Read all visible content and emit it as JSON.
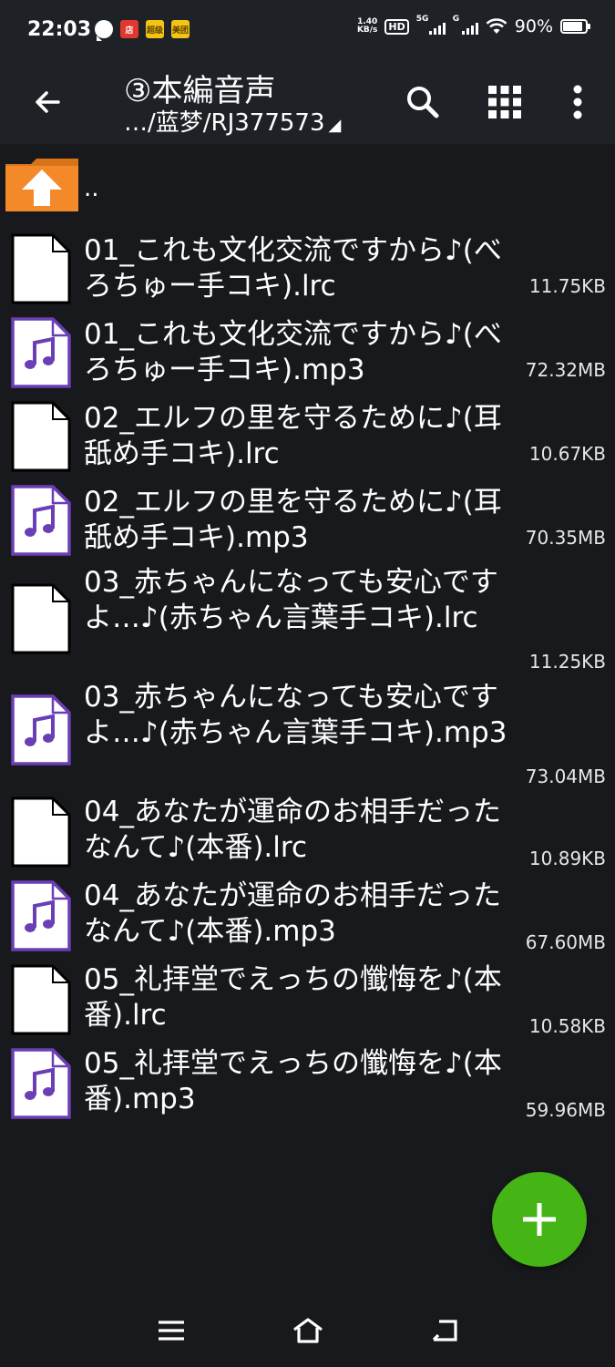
{
  "status_bar": {
    "time": "22:03",
    "badge_1": "店",
    "badge_2": "超级",
    "badge_3": "美团",
    "speed_value": "1.40",
    "speed_unit": "KB/s",
    "hd_label": "HD",
    "sig1_label": "5G",
    "sig2_label": "G",
    "battery": "90%"
  },
  "app_bar": {
    "title": "③本編音声",
    "path": "…/蓝梦/RJ377573",
    "path_indicator": "◢"
  },
  "parent_dir": {
    "label": ".."
  },
  "files": [
    {
      "name": "01_これも文化交流ですから♪(べろちゅー手コキ).lrc",
      "size": "11.75KB",
      "type": "document"
    },
    {
      "name": "01_これも文化交流ですから♪(べろちゅー手コキ).mp3",
      "size": "72.32MB",
      "type": "audio"
    },
    {
      "name": "02_エルフの里を守るために♪(耳舐め手コキ).lrc",
      "size": "10.67KB",
      "type": "document"
    },
    {
      "name": "02_エルフの里を守るために♪(耳舐め手コキ).mp3",
      "size": "70.35MB",
      "type": "audio"
    },
    {
      "name": "03_赤ちゃんになっても安心ですよ…♪(赤ちゃん言葉手コキ).lrc",
      "size": "11.25KB",
      "type": "document"
    },
    {
      "name": "03_赤ちゃんになっても安心ですよ…♪(赤ちゃん言葉手コキ).mp3",
      "size": "73.04MB",
      "type": "audio"
    },
    {
      "name": "04_あなたが運命のお相手だったなんて♪(本番).lrc",
      "size": "10.89KB",
      "type": "document"
    },
    {
      "name": "04_あなたが運命のお相手だったなんて♪(本番).mp3",
      "size": "67.60MB",
      "type": "audio"
    },
    {
      "name": "05_礼拝堂でえっちの懺悔を♪(本番).lrc",
      "size": "10.58KB",
      "type": "document"
    },
    {
      "name": "05_礼拝堂でえっちの懺悔を♪(本番).mp3",
      "size": "59.96MB",
      "type": "audio"
    }
  ],
  "colors": {
    "background": "#17191c",
    "appbar": "#1e2227",
    "fab": "#45b516",
    "audio_icon_border": "#6a3fb5",
    "folder": "#f4892a"
  },
  "icons": {
    "back": "arrow-left-icon",
    "search": "search-icon",
    "grid": "grid-icon",
    "more": "more-vertical-icon",
    "fab": "plus-icon",
    "nav_menu": "menu-icon",
    "nav_home": "home-icon",
    "nav_back": "back-icon"
  }
}
